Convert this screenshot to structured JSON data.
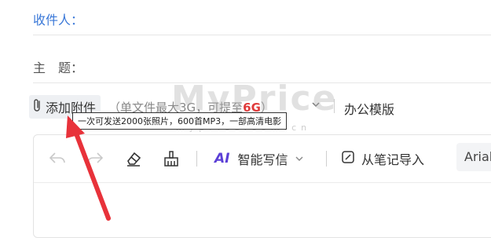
{
  "recipient": {
    "label": "收件人："
  },
  "subject": {
    "label": "主　题："
  },
  "attachment": {
    "button_label": "添加附件",
    "hint_prefix": "（单文件最大3G，可提至",
    "hint_highlight": "6G",
    "hint_suffix": "）",
    "highlight_color": "#e03b3b"
  },
  "template_label": "办公模版",
  "tooltip_text": "一次可发送2000张照片，600首MP3，一部高清电影",
  "toolbar": {
    "ai_badge": "AI",
    "ai_write_label": "智能写信",
    "import_notes_label": "从笔记导入",
    "font_value": "Arial"
  },
  "watermark": {
    "main": "MyPrice",
    "sub": "myprice.com.cn"
  },
  "colors": {
    "accent": "#3a78d8",
    "ai_purple": "#5b3fd6",
    "arrow_red": "#e8323a"
  },
  "icons": [
    "paperclip-icon",
    "chevron-down-icon",
    "undo-icon",
    "redo-icon",
    "eraser-icon",
    "format-brush-icon",
    "note-import-icon"
  ]
}
